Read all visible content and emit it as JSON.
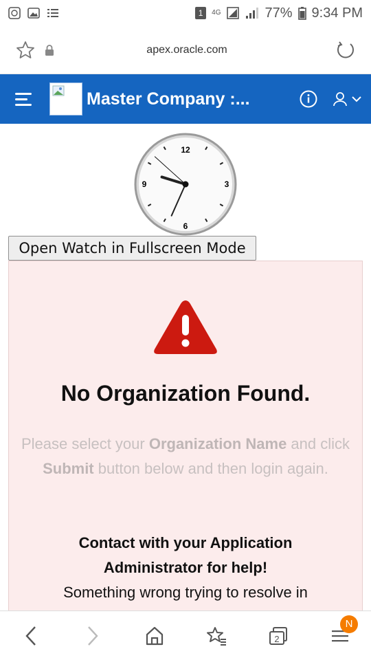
{
  "status_bar": {
    "sim_badge": "1",
    "network": "4G",
    "battery": "77%",
    "time": "9:34 PM"
  },
  "browser": {
    "url": "apex.oracle.com",
    "tab_count": "2",
    "menu_badge": "N"
  },
  "app": {
    "title": "Master Company :..."
  },
  "clock": {
    "numbers": [
      "12",
      "3",
      "6",
      "9"
    ],
    "hour": 9,
    "minute": 34,
    "second": 52
  },
  "main": {
    "fullscreen_button": "Open Watch in Fullscreen Mode",
    "alert_heading": "No Organization Found.",
    "instruction": {
      "part1": "Please select your ",
      "org_name": "Organization Name",
      "part2": " and click ",
      "submit": "Submit",
      "part3": " button below and then login again."
    },
    "contact_line1": "Contact with your Application",
    "contact_line2": "Administrator for help!",
    "contact_line3": "Something wrong trying to resolve in"
  },
  "colors": {
    "appbar": "#1565c0",
    "alert_bg": "#fcecec",
    "warning": "#cc1a10",
    "badge": "#f57c00"
  }
}
